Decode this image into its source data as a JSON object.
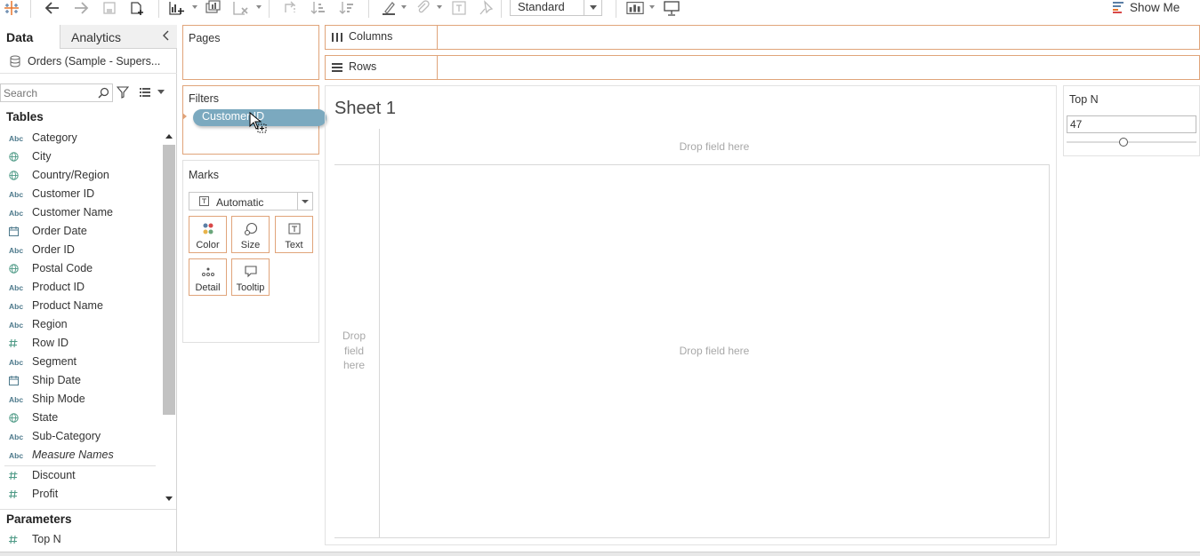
{
  "toolbar": {
    "style_select_value": "Standard",
    "show_me_label": "Show Me",
    "icons": [
      "tableau-logo-icon",
      "undo-icon",
      "redo-icon",
      "save-icon",
      "new-datasource-icon",
      "new-worksheet-icon",
      "duplicate-sheet-icon",
      "clear-sheet-icon",
      "swap-icon",
      "sort-ascending-icon",
      "sort-descending-icon",
      "highlight-icon",
      "group-icon",
      "label-icon",
      "pin-icon",
      "chart-type-icon",
      "presentation-icon"
    ]
  },
  "data_pane": {
    "tabs": [
      {
        "label": "Data"
      },
      {
        "label": "Analytics"
      }
    ],
    "datasource_label": "Orders (Sample - Supers...",
    "search_placeholder": "Search",
    "tables_header": "Tables",
    "fields": [
      {
        "icon": "Abc",
        "label": "Category"
      },
      {
        "icon": "globe",
        "label": "City"
      },
      {
        "icon": "globe",
        "label": "Country/Region"
      },
      {
        "icon": "Abc",
        "label": "Customer ID"
      },
      {
        "icon": "Abc",
        "label": "Customer Name"
      },
      {
        "icon": "calendar",
        "label": "Order Date"
      },
      {
        "icon": "Abc",
        "label": "Order ID"
      },
      {
        "icon": "globe",
        "label": "Postal Code"
      },
      {
        "icon": "Abc",
        "label": "Product ID"
      },
      {
        "icon": "Abc",
        "label": "Product Name"
      },
      {
        "icon": "Abc",
        "label": "Region"
      },
      {
        "icon": "#",
        "label": "Row ID"
      },
      {
        "icon": "Abc",
        "label": "Segment"
      },
      {
        "icon": "calendar",
        "label": "Ship Date"
      },
      {
        "icon": "Abc",
        "label": "Ship Mode"
      },
      {
        "icon": "globe",
        "label": "State"
      },
      {
        "icon": "Abc",
        "label": "Sub-Category"
      },
      {
        "icon": "Abc",
        "label": "Measure Names",
        "italic": true
      },
      {
        "icon": "#",
        "label": "Discount"
      },
      {
        "icon": "#",
        "label": "Profit"
      }
    ],
    "parameters_header": "Parameters",
    "parameters": [
      {
        "icon": "#",
        "label": "Top N"
      }
    ]
  },
  "pages_card": {
    "title": "Pages"
  },
  "filters_card": {
    "title": "Filters",
    "pill_label": "Customer ID"
  },
  "marks_card": {
    "title": "Marks",
    "mark_type": "Automatic",
    "buttons": [
      {
        "label": "Color",
        "icon": "color-icon"
      },
      {
        "label": "Size",
        "icon": "size-icon"
      },
      {
        "label": "Text",
        "icon": "text-icon"
      },
      {
        "label": "Detail",
        "icon": "detail-icon"
      },
      {
        "label": "Tooltip",
        "icon": "tooltip-icon"
      }
    ]
  },
  "shelves": {
    "columns_label": "Columns",
    "rows_label": "Rows"
  },
  "view": {
    "sheet_title": "Sheet 1",
    "drop_top": "Drop field here",
    "drop_left": "Drop field here",
    "drop_center": "Drop field here"
  },
  "parameter_control": {
    "title": "Top N",
    "value": "47",
    "slider_fraction": 0.44
  },
  "colors": {
    "accent_border": "#e0a47a",
    "pill": "#7ba9bf",
    "field_icon": "#4e7a8c"
  }
}
